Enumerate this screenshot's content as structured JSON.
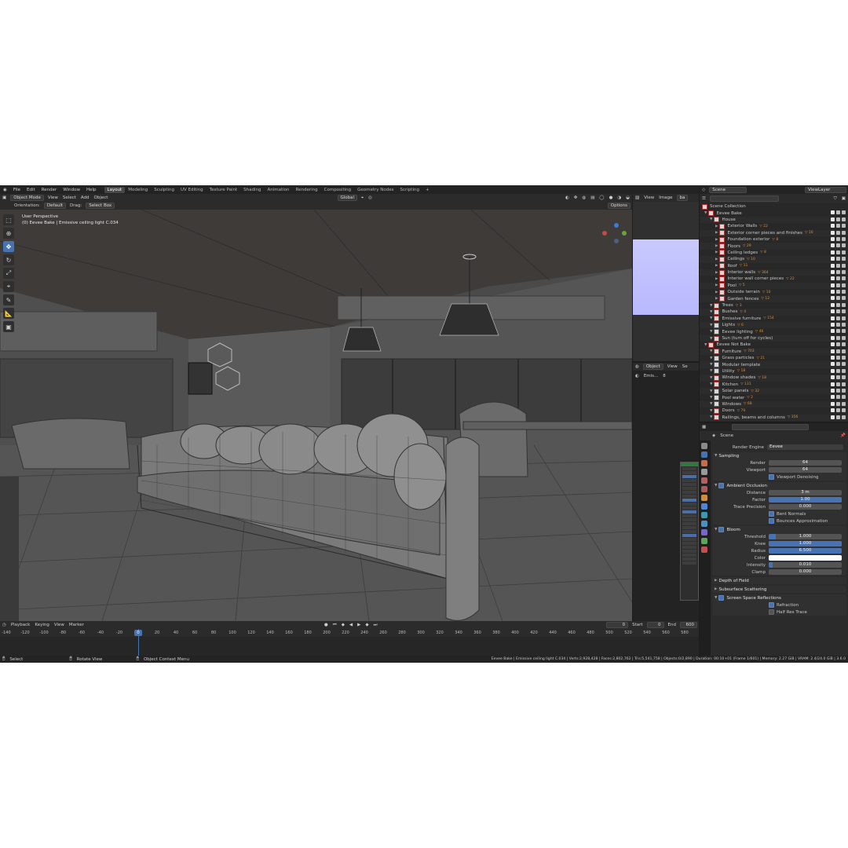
{
  "topbar": {
    "menus": [
      "File",
      "Edit",
      "Render",
      "Window",
      "Help"
    ],
    "workspaces": [
      "Layout",
      "Modeling",
      "Sculpting",
      "UV Editing",
      "Texture Paint",
      "Shading",
      "Animation",
      "Rendering",
      "Compositing",
      "Geometry Nodes",
      "Scripting"
    ],
    "active_workspace": "Layout",
    "add_tab": "+",
    "scene_label": "Scene",
    "viewlayer_label": "ViewLayer"
  },
  "viewport": {
    "mode": "Object Mode",
    "menus": [
      "View",
      "Select",
      "Add",
      "Object"
    ],
    "transform_orientation": "Global",
    "orientation_label": "Orientation:",
    "orientation_value": "Default",
    "drag_label": "Drag:",
    "drag_value": "Select Box",
    "options_label": "Options",
    "info_line1": "User Perspective",
    "info_line2": "(0) Eevee Bake | Emissive ceiling light C.034"
  },
  "image_editor": {
    "menus": [
      "View",
      "Image"
    ],
    "image_name": "ba"
  },
  "node_editor": {
    "type": "Object",
    "menus": [
      "View",
      "Se"
    ],
    "object_name": "Emis...",
    "slot": "8"
  },
  "outliner": {
    "search_placeholder": "",
    "root": "Scene Collection",
    "rows": [
      {
        "label": "Eevee Bake",
        "level": 0
      },
      {
        "label": "House",
        "level": 1
      },
      {
        "label": "Exterior Walls",
        "level": 2,
        "mod": "▽ 22"
      },
      {
        "label": "Exterior corner pieces and finishes",
        "level": 2,
        "mod": "▽ 16"
      },
      {
        "label": "Foundation exterior",
        "level": 2,
        "mod": "▽ 8"
      },
      {
        "label": "Floors",
        "level": 2,
        "mod": "▽ 29"
      },
      {
        "label": "Ceiling ledges",
        "level": 2,
        "mod": "▽ 8"
      },
      {
        "label": "Ceilings",
        "level": 2,
        "mod": "▽ 10"
      },
      {
        "label": "Roof",
        "level": 2,
        "mod": "▽ 11"
      },
      {
        "label": "Interior walls",
        "level": 2,
        "mod": "▽ 364"
      },
      {
        "label": "Interior wall corner pieces",
        "level": 2,
        "mod": "▽ 22"
      },
      {
        "label": "Pool",
        "level": 2,
        "mod": "▽ 5"
      },
      {
        "label": "Outside terrain",
        "level": 2,
        "mod": "▽ 10"
      },
      {
        "label": "Garden fences",
        "level": 2,
        "mod": "▽ 12"
      },
      {
        "label": "Trees",
        "level": 1,
        "mod": "▽ 3"
      },
      {
        "label": "Bushes",
        "level": 1,
        "mod": "▽ 4"
      },
      {
        "label": "Emissive furniture",
        "level": 1,
        "mod": "▽ 154"
      },
      {
        "label": "Lights",
        "level": 1,
        "mod": "▽ 6"
      },
      {
        "label": "Eevee lighting",
        "level": 1,
        "mod": "▽ 46"
      },
      {
        "label": "Sun (turn off for cycles)",
        "level": 1,
        "mod": ""
      },
      {
        "label": "Eevee Not Bake",
        "level": 0
      },
      {
        "label": "Furniture",
        "level": 1,
        "mod": "▽ 703"
      },
      {
        "label": "Grass particles",
        "level": 1,
        "mod": "▽ 21"
      },
      {
        "label": "Modular template",
        "level": 1,
        "mod": ""
      },
      {
        "label": "Utility",
        "level": 1,
        "mod": "▽ 18"
      },
      {
        "label": "Window shades",
        "level": 1,
        "mod": "▽ 18"
      },
      {
        "label": "Kitchen",
        "level": 1,
        "mod": "▽ 131"
      },
      {
        "label": "Solar panels",
        "level": 1,
        "mod": "▽ 32"
      },
      {
        "label": "Pool water",
        "level": 1,
        "mod": "▽ 2"
      },
      {
        "label": "Windows",
        "level": 1,
        "mod": "▽ 68"
      },
      {
        "label": "Doors",
        "level": 1,
        "mod": "▽ 79"
      },
      {
        "label": "Railings, beams and columns",
        "level": 1,
        "mod": "▽ 356"
      }
    ]
  },
  "properties": {
    "breadcrumb": "Scene",
    "render_engine_label": "Render Engine",
    "render_engine_value": "Eevee",
    "sampling": {
      "title": "Sampling",
      "render_label": "Render",
      "render_value": "64",
      "viewport_label": "Viewport",
      "viewport_value": "64",
      "denoise_label": "Viewport Denoising"
    },
    "ao": {
      "title": "Ambient Occlusion",
      "distance_label": "Distance",
      "distance_value": "3 m",
      "factor_label": "Factor",
      "factor_value": "1.00",
      "factor_fill": 1.0,
      "trace_label": "Trace Precision",
      "trace_value": "0.000",
      "bent_label": "Bent Normals",
      "bounces_label": "Bounces Approximation"
    },
    "bloom": {
      "title": "Bloom",
      "threshold_label": "Threshold",
      "threshold_value": "1.000",
      "threshold_fill": 0.1,
      "knee_label": "Knee",
      "knee_value": "1.000",
      "knee_fill": 1.0,
      "radius_label": "Radius",
      "radius_value": "6.500",
      "radius_fill": 1.0,
      "color_label": "Color",
      "intensity_label": "Intensity",
      "intensity_value": "0.010",
      "intensity_fill": 0.05,
      "clamp_label": "Clamp",
      "clamp_value": "0.000"
    },
    "dof": {
      "title": "Depth of Field"
    },
    "sss": {
      "title": "Subsurface Scattering"
    },
    "ssr": {
      "title": "Screen Space Reflections",
      "refraction_label": "Refraction",
      "halfres_label": "Half Res Trace"
    }
  },
  "timeline": {
    "menus": [
      "Playback",
      "Keying",
      "View",
      "Marker"
    ],
    "current_frame": "0",
    "start_label": "Start",
    "start_value": "0",
    "end_label": "End",
    "end_value": "600",
    "ticks": [
      "-140",
      "-120",
      "-100",
      "-80",
      "-60",
      "-40",
      "-20",
      "0",
      "20",
      "40",
      "60",
      "80",
      "100",
      "120",
      "140",
      "160",
      "180",
      "200",
      "220",
      "240",
      "260",
      "280",
      "300",
      "320",
      "340",
      "360",
      "380",
      "400",
      "420",
      "440",
      "460",
      "480",
      "500",
      "520",
      "540",
      "560",
      "580"
    ]
  },
  "status": {
    "select": "Select",
    "rotate": "Rotate View",
    "context": "Object Context Menu",
    "stats": "Eevee Bake | Emissive ceiling light C.034 | Verts:2,928,428 | Faces:2,802,762 | Tris:5,541,758 | Objects:0/2,890 | Duration: 00:10+01 (Frame 1/601) | Memory: 2.27 GiB | VRAM: 2.4/24.0 GiB | 3.6.0"
  },
  "colors": {
    "accent": "#4772b3",
    "collection_red": "#c54040",
    "modifier_orange": "#d88f3b",
    "image_preview": "#bfbfff"
  }
}
